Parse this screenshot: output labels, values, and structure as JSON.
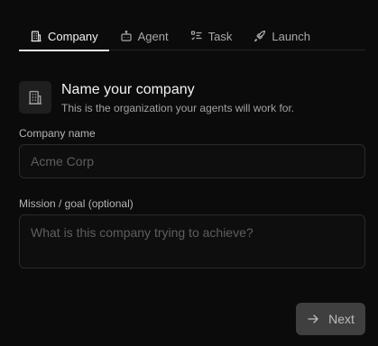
{
  "tabs": [
    {
      "label": "Company",
      "icon": "building-icon",
      "active": true
    },
    {
      "label": "Agent",
      "icon": "bot-icon",
      "active": false
    },
    {
      "label": "Task",
      "icon": "checklist-icon",
      "active": false
    },
    {
      "label": "Launch",
      "icon": "rocket-icon",
      "active": false
    }
  ],
  "header": {
    "icon": "building-icon",
    "title": "Name your company",
    "subtitle": "This is the organization your agents will work for."
  },
  "form": {
    "company_name": {
      "label": "Company name",
      "value": "",
      "placeholder": "Acme Corp"
    },
    "mission": {
      "label": "Mission / goal (optional)",
      "value": "",
      "placeholder": "What is this company trying to achieve?"
    }
  },
  "actions": {
    "next_label": "Next",
    "next_icon": "arrow-right-icon"
  },
  "colors": {
    "background": "#0b0b0b",
    "active_underline": "#f0f0f0",
    "button_bg": "#3f3f3f"
  }
}
